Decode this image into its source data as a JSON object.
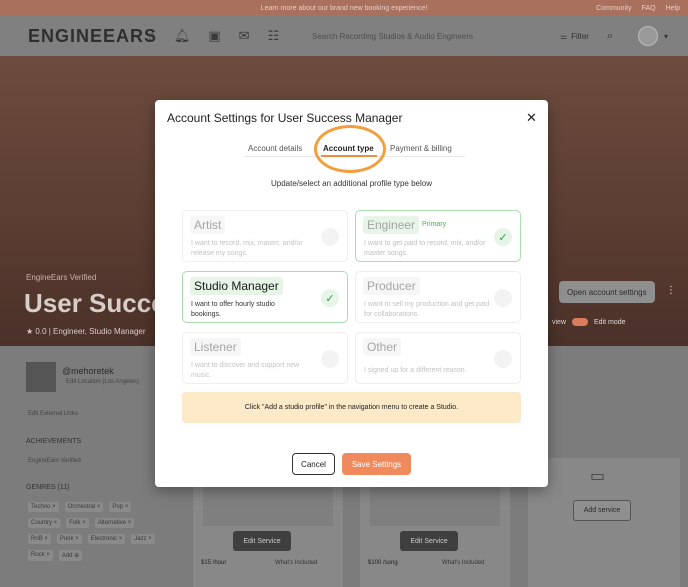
{
  "announcement": {
    "message": "Learn more about our brand new booking experience!",
    "links": [
      "Community",
      "FAQ",
      "Help"
    ]
  },
  "navbar": {
    "logo": "ENGINEEARS",
    "search_placeholder": "Search Recording Studios & Audio Engineers",
    "filter_label": "Filter"
  },
  "profile_header": {
    "verified_label": "EngineEars Verified",
    "name_partial": "User Succes",
    "rating_line": "★ 0.0 | Engineer, Studio Manager",
    "account_settings_button": "Open account settings",
    "view_label": "view",
    "edit_mode_label": "Edit mode"
  },
  "profile_body": {
    "handle": "@mehoretek",
    "location": "Edit Location (Los Angeles)",
    "external_links": "Edit External Links",
    "achievements_heading": "ACHIEVEMENTS",
    "achievement_badge": "EngineEars Verified",
    "genres_heading": "GENRES (11)",
    "genres": [
      "Techno ×",
      "Orchestral ×",
      "Pop ×",
      "Country ×",
      "Folk ×",
      "Alternative ×",
      "RnB ×",
      "Punk ×",
      "Electronic ×",
      "Jazz ×",
      "Rock ×",
      "Add ⊕"
    ]
  },
  "services": [
    {
      "edit_label": "Edit Service",
      "price": "$15 /hour",
      "included": "What's Included"
    },
    {
      "edit_label": "Edit Service",
      "price": "$100 /song",
      "included": "What's Included"
    }
  ],
  "add_service_label": "Add service",
  "modal": {
    "title": "Account Settings for User Success Manager",
    "close_glyph": "✕",
    "tabs": [
      {
        "label": "Account details",
        "active": false
      },
      {
        "label": "Account type",
        "active": true
      },
      {
        "label": "Payment & billing",
        "active": false
      }
    ],
    "subtitle": "Update/select an additional profile type below",
    "primary_label": "Primary",
    "check_glyph": "✓",
    "cards": [
      {
        "name": "Artist",
        "description": "I want to record, mix, master, and/or release my songs."
      },
      {
        "name": "Engineer",
        "description": "I want to get paid to record, mix, and/or master songs."
      },
      {
        "name": "Studio Manager",
        "description": "I want to offer hourly studio bookings."
      },
      {
        "name": "Producer",
        "description": "I want to sell my production and get paid for collaborations."
      },
      {
        "name": "Listener",
        "description": "I want to discover and support new music."
      },
      {
        "name": "Other",
        "description": "I signed up for a different reason."
      }
    ],
    "notice": "Click \"Add a studio profile\" in the navigation menu to create a Studio.",
    "cancel_label": "Cancel",
    "save_label": "Save Settings"
  },
  "colors": {
    "accent_orange": "#f08a5d",
    "selected_green": "#2e9b3a",
    "highlight_circle": "#f39d3c",
    "notice_bg": "#fbe9c7"
  }
}
